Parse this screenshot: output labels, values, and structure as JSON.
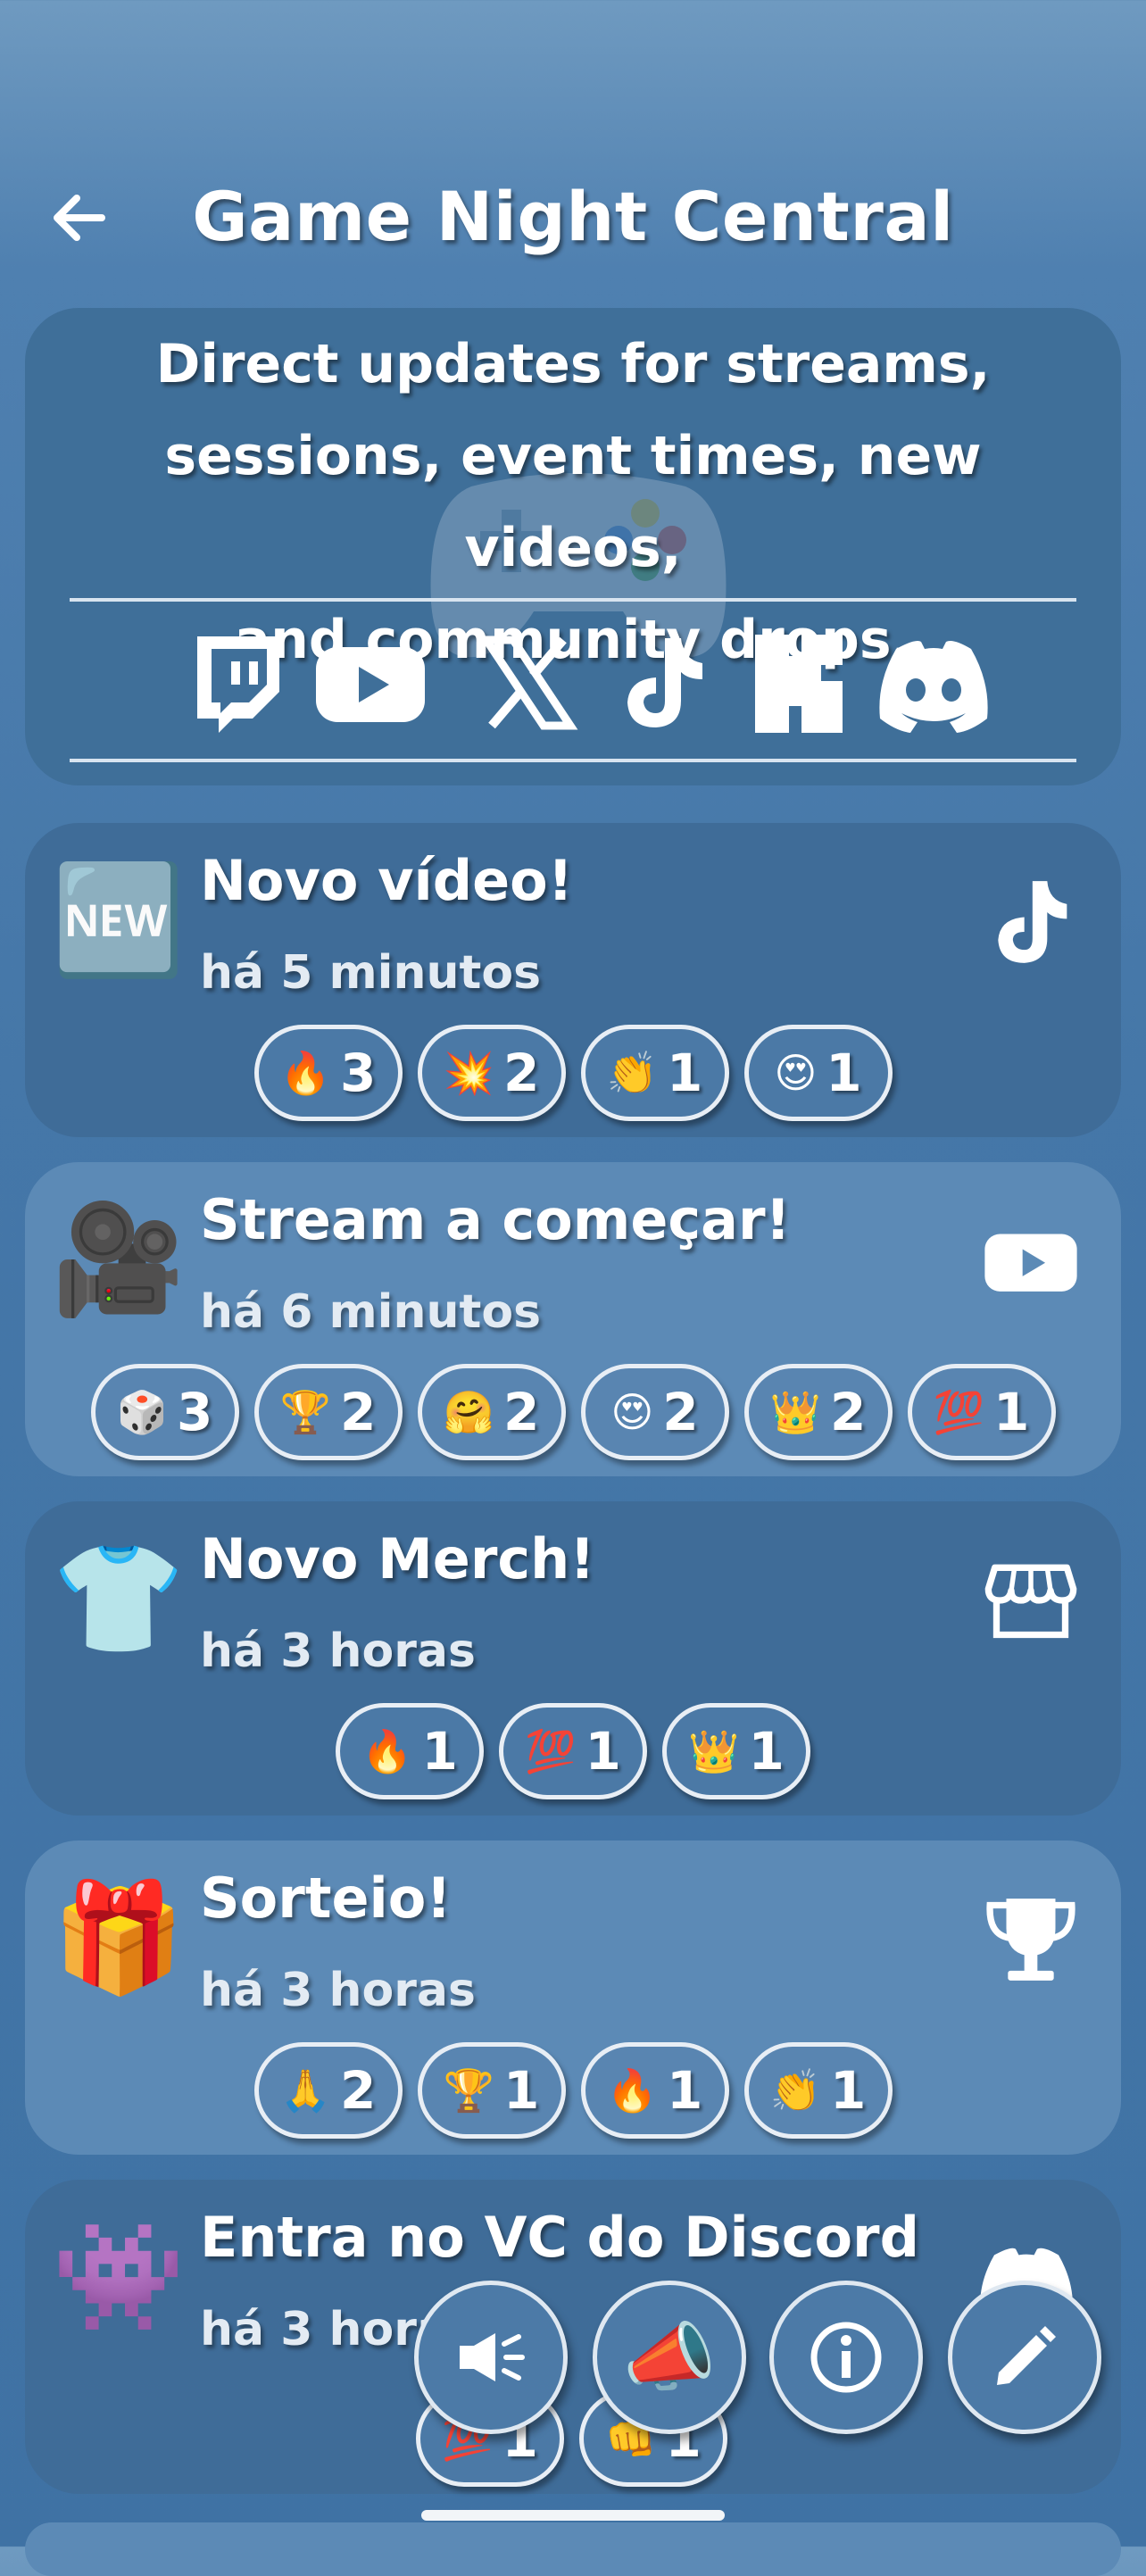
{
  "header": {
    "title": "Game Night Central"
  },
  "info": {
    "lines": [
      "Direct updates for streams,",
      "sessions, event times, new videos,",
      "and community drops."
    ],
    "socials": [
      "twitch-icon",
      "youtube-icon",
      "x-icon",
      "tiktok-icon",
      "kick-icon",
      "discord-icon"
    ]
  },
  "feed": [
    {
      "emoji": "🆕",
      "title": "Novo vídeo!",
      "time": "há 5 minutos",
      "platform": "tiktok-icon",
      "reactions": [
        {
          "emoji": "🔥",
          "count": "3"
        },
        {
          "emoji": "💥",
          "count": "2"
        },
        {
          "emoji": "👏",
          "count": "1"
        },
        {
          "emoji": "😍",
          "count": "1"
        }
      ]
    },
    {
      "emoji": "🎥",
      "title": "Stream a começar!",
      "time": "há 6 minutos",
      "platform": "youtube-icon",
      "reactions": [
        {
          "emoji": "🎲",
          "count": "3"
        },
        {
          "emoji": "🏆",
          "count": "2"
        },
        {
          "emoji": "🤗",
          "count": "2"
        },
        {
          "emoji": "😍",
          "count": "2"
        },
        {
          "emoji": "👑",
          "count": "2"
        },
        {
          "emoji": "💯",
          "count": "1"
        }
      ]
    },
    {
      "emoji": "👕",
      "title": "Novo Merch!",
      "time": "há 3 horas",
      "platform": "store-icon",
      "reactions": [
        {
          "emoji": "🔥",
          "count": "1"
        },
        {
          "emoji": "💯",
          "count": "1"
        },
        {
          "emoji": "👑",
          "count": "1"
        }
      ]
    },
    {
      "emoji": "🎁",
      "title": "Sorteio!",
      "time": "há 3 horas",
      "platform": "trophy-icon",
      "reactions": [
        {
          "emoji": "🙏",
          "count": "2"
        },
        {
          "emoji": "🏆",
          "count": "1"
        },
        {
          "emoji": "🔥",
          "count": "1"
        },
        {
          "emoji": "👏",
          "count": "1"
        }
      ]
    },
    {
      "emoji": "👾",
      "title": "Entra no VC do Discord",
      "time": "há 3 hora",
      "platform": "discord-icon",
      "reactions": [
        {
          "emoji": "💯",
          "count": "1"
        },
        {
          "emoji": "👊",
          "count": "1"
        }
      ]
    }
  ],
  "fabs": [
    "announce-icon",
    "megaphone-icon",
    "info-icon",
    "edit-icon"
  ],
  "colors": {
    "card_dark": "#3f6c98",
    "card_light": "#5c8ab6",
    "pill_border": "#e8eef5",
    "background": "#4577a8"
  }
}
